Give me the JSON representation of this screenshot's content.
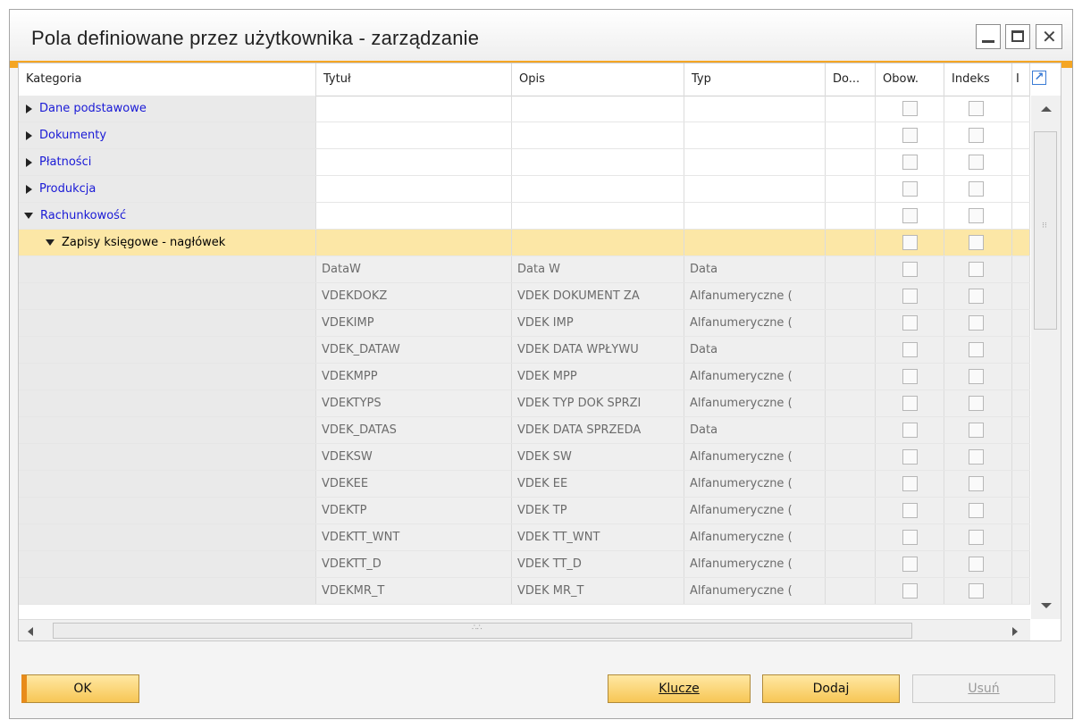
{
  "window": {
    "title": "Pola definiowane przez użytkownika - zarządzanie"
  },
  "colors": {
    "accent": "#f5a623",
    "link": "#1a1ad6",
    "selected_row": "#fce7a6",
    "button": "#f7c655"
  },
  "grid": {
    "columns": [
      "Kategoria",
      "Tytuł",
      "Opis",
      "Typ",
      "Do...",
      "Obow.",
      "Indeks",
      "I"
    ],
    "categories": [
      {
        "label": "Dane podstawowe",
        "expanded": false
      },
      {
        "label": "Dokumenty",
        "expanded": false
      },
      {
        "label": "Płatności",
        "expanded": false
      },
      {
        "label": "Produkcja",
        "expanded": false
      },
      {
        "label": "Rachunkowość",
        "expanded": true
      }
    ],
    "subcategory": {
      "label": "Zapisy księgowe - nagłówek",
      "expanded": true
    },
    "fields": [
      {
        "title": "DataW",
        "desc": "Data W",
        "type": "Data"
      },
      {
        "title": "VDEKDOKZ",
        "desc": "VDEK DOKUMENT ZA",
        "type": "Alfanumeryczne ("
      },
      {
        "title": "VDEKIMP",
        "desc": "VDEK IMP",
        "type": "Alfanumeryczne ("
      },
      {
        "title": "VDEK_DATAW",
        "desc": "VDEK DATA WPŁYWU",
        "type": "Data"
      },
      {
        "title": "VDEKMPP",
        "desc": "VDEK MPP",
        "type": "Alfanumeryczne ("
      },
      {
        "title": "VDEKTYPS",
        "desc": "VDEK TYP DOK SPRZI",
        "type": "Alfanumeryczne ("
      },
      {
        "title": "VDEK_DATAS",
        "desc": "VDEK DATA SPRZEDA",
        "type": "Data"
      },
      {
        "title": "VDEKSW",
        "desc": "VDEK SW",
        "type": "Alfanumeryczne ("
      },
      {
        "title": "VDEKEE",
        "desc": "VDEK EE",
        "type": "Alfanumeryczne ("
      },
      {
        "title": "VDEKTP",
        "desc": "VDEK TP",
        "type": "Alfanumeryczne ("
      },
      {
        "title": "VDEKTT_WNT",
        "desc": "VDEK TT_WNT",
        "type": "Alfanumeryczne ("
      },
      {
        "title": "VDEKTT_D",
        "desc": "VDEK TT_D",
        "type": "Alfanumeryczne ("
      },
      {
        "title": "VDEKMR_T",
        "desc": "VDEK MR_T",
        "type": "Alfanumeryczne ("
      }
    ]
  },
  "buttons": {
    "ok": "OK",
    "keys": "Klucze",
    "add": "Dodaj",
    "remove": "Usuń"
  }
}
